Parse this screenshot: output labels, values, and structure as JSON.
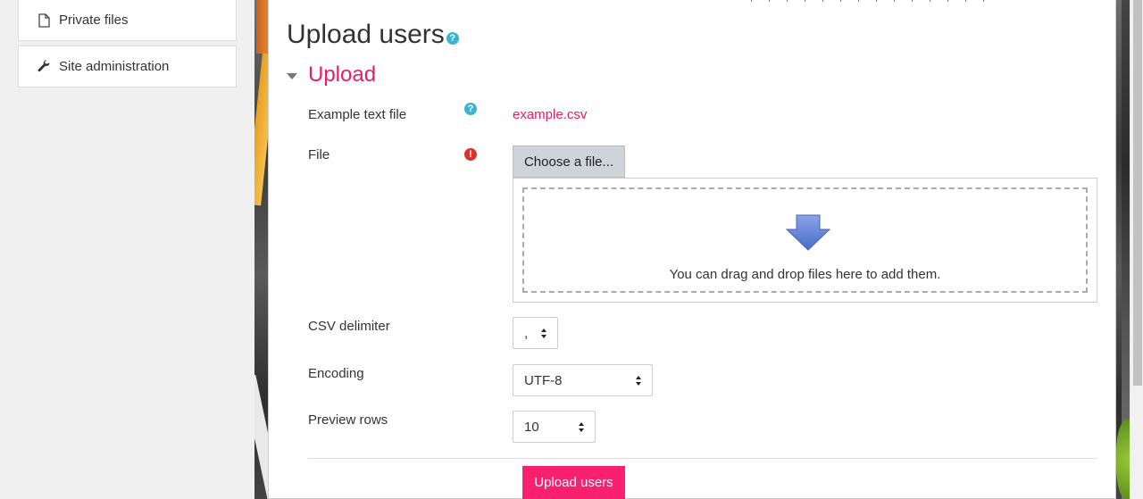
{
  "nav": {
    "items": [
      {
        "label": "Private files",
        "icon": "file-icon"
      },
      {
        "label": "Site administration",
        "icon": "wrench-icon"
      }
    ]
  },
  "page": {
    "title": "Upload users",
    "section_title": "Upload"
  },
  "form": {
    "example_label": "Example text file",
    "example_link": "example.csv",
    "file_label": "File",
    "choose_button": "Choose a file...",
    "drop_text": "You can drag and drop files here to add them.",
    "delimiter_label": "CSV delimiter",
    "delimiter_value": ",",
    "encoding_label": "Encoding",
    "encoding_value": "UTF-8",
    "preview_label": "Preview rows",
    "preview_value": "10",
    "submit_label": "Upload users"
  },
  "colors": {
    "accent": "#e91e63",
    "button": "#f9206e",
    "help": "#3ab4d4",
    "required": "#d9342b"
  }
}
